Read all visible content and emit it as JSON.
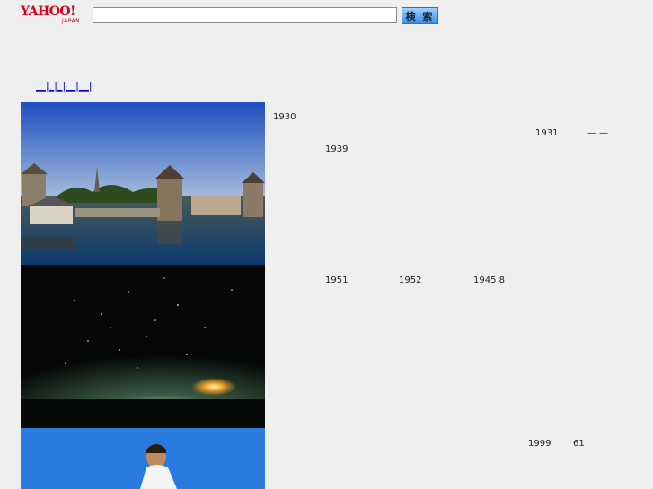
{
  "header": {
    "logo_text": "YAHOO!",
    "logo_sub": "JAPAN",
    "search_placeholder": "",
    "search_button_label": "検 索"
  },
  "nav": {
    "items": [
      "__",
      "_",
      "_",
      "__",
      "__"
    ]
  },
  "content": {
    "year_1930": "1930",
    "year_1931": "1931",
    "dashes": "— —",
    "year_1939": "1939",
    "year_1951": "1951",
    "year_1952": "1952",
    "year_1945": "1945 8",
    "year_1999": "1999",
    "num_61": "61"
  },
  "colors": {
    "background": "#efefef",
    "logo": "#d4001e",
    "link": "#0000cc"
  }
}
